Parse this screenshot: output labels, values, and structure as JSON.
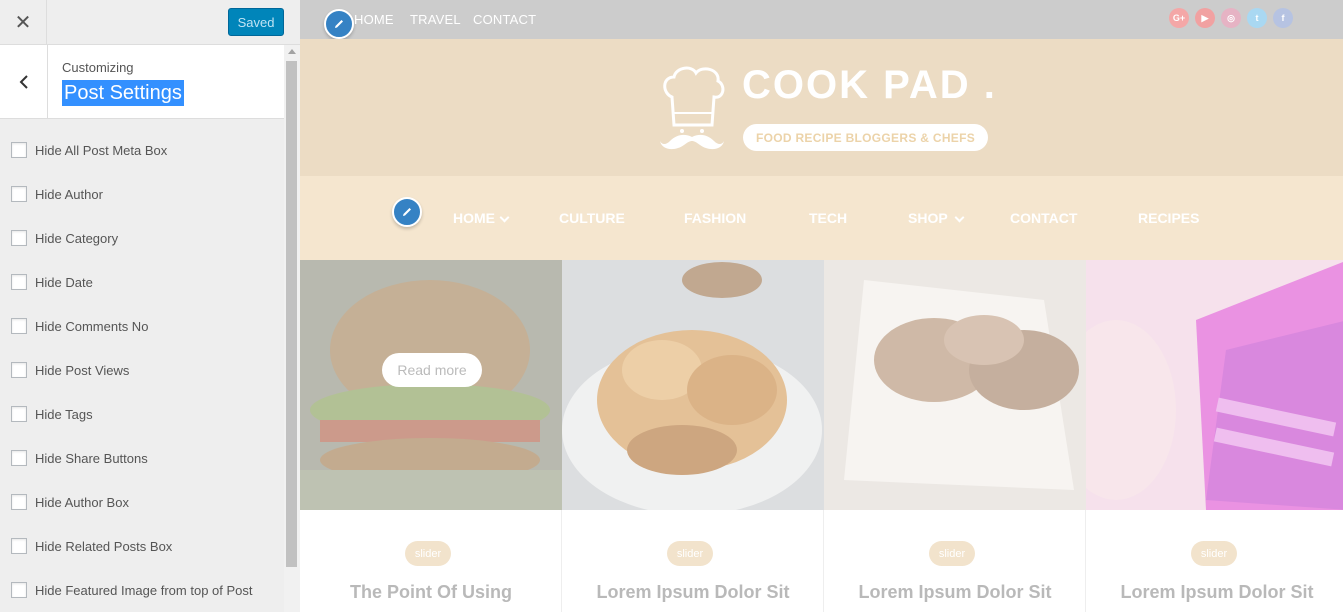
{
  "panel": {
    "close_icon": "close-icon",
    "saved_label": "Saved",
    "back_icon": "chevron-left-icon",
    "breadcrumb": "Customizing",
    "title": "Post Settings",
    "options": [
      {
        "label": "Hide All Post Meta Box",
        "checked": false
      },
      {
        "label": "Hide Author",
        "checked": false
      },
      {
        "label": "Hide Category",
        "checked": false
      },
      {
        "label": "Hide Date",
        "checked": false
      },
      {
        "label": "Hide Comments No",
        "checked": false
      },
      {
        "label": "Hide Post Views",
        "checked": false
      },
      {
        "label": "Hide Tags",
        "checked": false
      },
      {
        "label": "Hide Share Buttons",
        "checked": false
      },
      {
        "label": "Hide Author Box",
        "checked": false
      },
      {
        "label": "Hide Related Posts Box",
        "checked": false
      },
      {
        "label": "Hide Featured Image from top of Post",
        "checked": false
      }
    ]
  },
  "preview": {
    "top_nav": [
      "HOME",
      "TRAVEL",
      "CONTACT"
    ],
    "social": [
      {
        "icon": "google-plus-icon",
        "glyph": "G+",
        "color": "#f4a7a7"
      },
      {
        "icon": "youtube-icon",
        "glyph": "▶",
        "color": "#f1a1a1"
      },
      {
        "icon": "instagram-icon",
        "glyph": "◎",
        "color": "#e6b3c4"
      },
      {
        "icon": "twitter-icon",
        "glyph": "t",
        "color": "#a9d8f2"
      },
      {
        "icon": "facebook-icon",
        "glyph": "f",
        "color": "#b6c3e2"
      }
    ],
    "logo_text": "COOK PAD .",
    "tagline": "FOOD RECIPE BLOGGERS & CHEFS",
    "main_nav": [
      {
        "label": "HOME",
        "has_dropdown": true
      },
      {
        "label": "CULTURE",
        "has_dropdown": false
      },
      {
        "label": "FASHION",
        "has_dropdown": false
      },
      {
        "label": "TECH",
        "has_dropdown": false
      },
      {
        "label": "SHOP",
        "has_dropdown": true
      },
      {
        "label": "CONTACT",
        "has_dropdown": false
      },
      {
        "label": "RECIPES",
        "has_dropdown": false
      }
    ],
    "read_more": "Read more",
    "slides": [
      {
        "badge": "slider",
        "title": "The Point Of Using"
      },
      {
        "badge": "slider",
        "title": "Lorem Ipsum Dolor Sit"
      },
      {
        "badge": "slider",
        "title": "Lorem Ipsum Dolor Sit"
      },
      {
        "badge": "slider",
        "title": "Lorem Ipsum Dolor Sit"
      }
    ],
    "colors": {
      "header_bg": "#ecdcc4",
      "nav_bg": "#f5e6cf",
      "accent_blue": "#3582c4",
      "saved_blue": "#0085ba"
    }
  }
}
